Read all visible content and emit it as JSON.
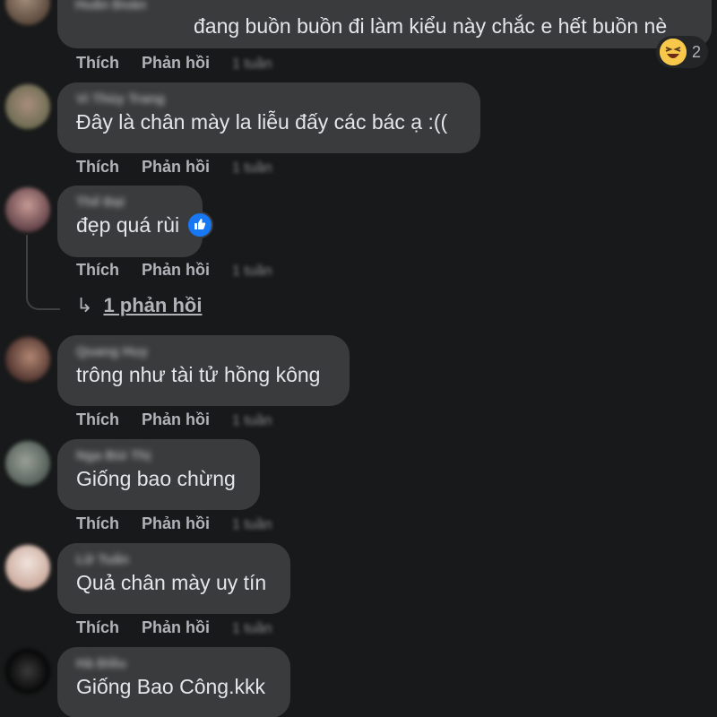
{
  "actions": {
    "like_label": "Thích",
    "reply_label": "Phản hồi",
    "time_label": "1 tuần"
  },
  "comments": [
    {
      "author": "Huấn Đoàn",
      "text": "đang buồn buồn đi làm kiểu này chắc e hết buồn nè",
      "reaction_count": "2",
      "reaction_icon": "laughing-emoji-icon"
    },
    {
      "author": "Vi Thùy Trang",
      "text": "Đây là chân mày la liễu đấy các bác ạ :(("
    },
    {
      "author": "Thế Đại",
      "text": "đẹp quá rùi",
      "reaction_icon": "like-thumbs-up-icon"
    },
    {
      "author": "Quang Huy",
      "text": "trông như tài tử hồng kông"
    },
    {
      "author": "Nga Bùi Thị",
      "text": "Giống bao chừng"
    },
    {
      "author": "Lữ Tuấn",
      "text": "Quả chân mày uy tín"
    },
    {
      "author": "Hà Điều",
      "text": "Giống Bao Công.kkk"
    }
  ],
  "replies_link": {
    "label": "1 phản hồi"
  },
  "colors": {
    "background": "#18191a",
    "bubble": "#3a3b3c",
    "text": "#e4e6eb",
    "secondary": "#b0b3b8",
    "like_blue": "#1877f2"
  }
}
